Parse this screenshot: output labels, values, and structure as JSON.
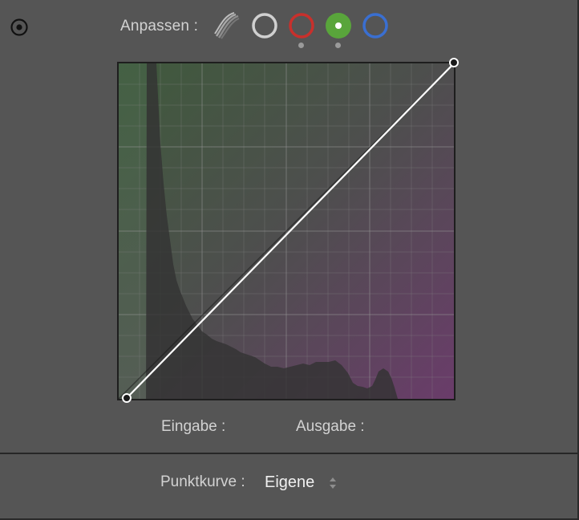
{
  "header": {
    "adjust_label": "Anpassen :",
    "target_icon": "target-adjust-icon",
    "channels": [
      {
        "name": "parametric",
        "icon": "parametric-curve-icon"
      },
      {
        "name": "rgb",
        "color": "#d0d0d0",
        "icon": "rgb-channel-icon"
      },
      {
        "name": "red",
        "color": "#c8302c",
        "icon": "red-channel-icon"
      },
      {
        "name": "green",
        "color": "#59a53b",
        "icon": "green-channel-icon",
        "selected": true
      },
      {
        "name": "blue",
        "color": "#3a6fd1",
        "icon": "blue-channel-icon"
      }
    ]
  },
  "curve": {
    "channel": "green",
    "points": [
      [
        0,
        0
      ],
      [
        255,
        255
      ]
    ],
    "colors": {
      "top_left": "#3f5a3c",
      "bottom_right": "#6a3c6a",
      "grid": "#8a8a8a"
    }
  },
  "readout": {
    "input_label": "Eingabe :",
    "output_label": "Ausgabe :"
  },
  "footer": {
    "point_curve_label": "Punktkurve :",
    "point_curve_value": "Eigene"
  }
}
